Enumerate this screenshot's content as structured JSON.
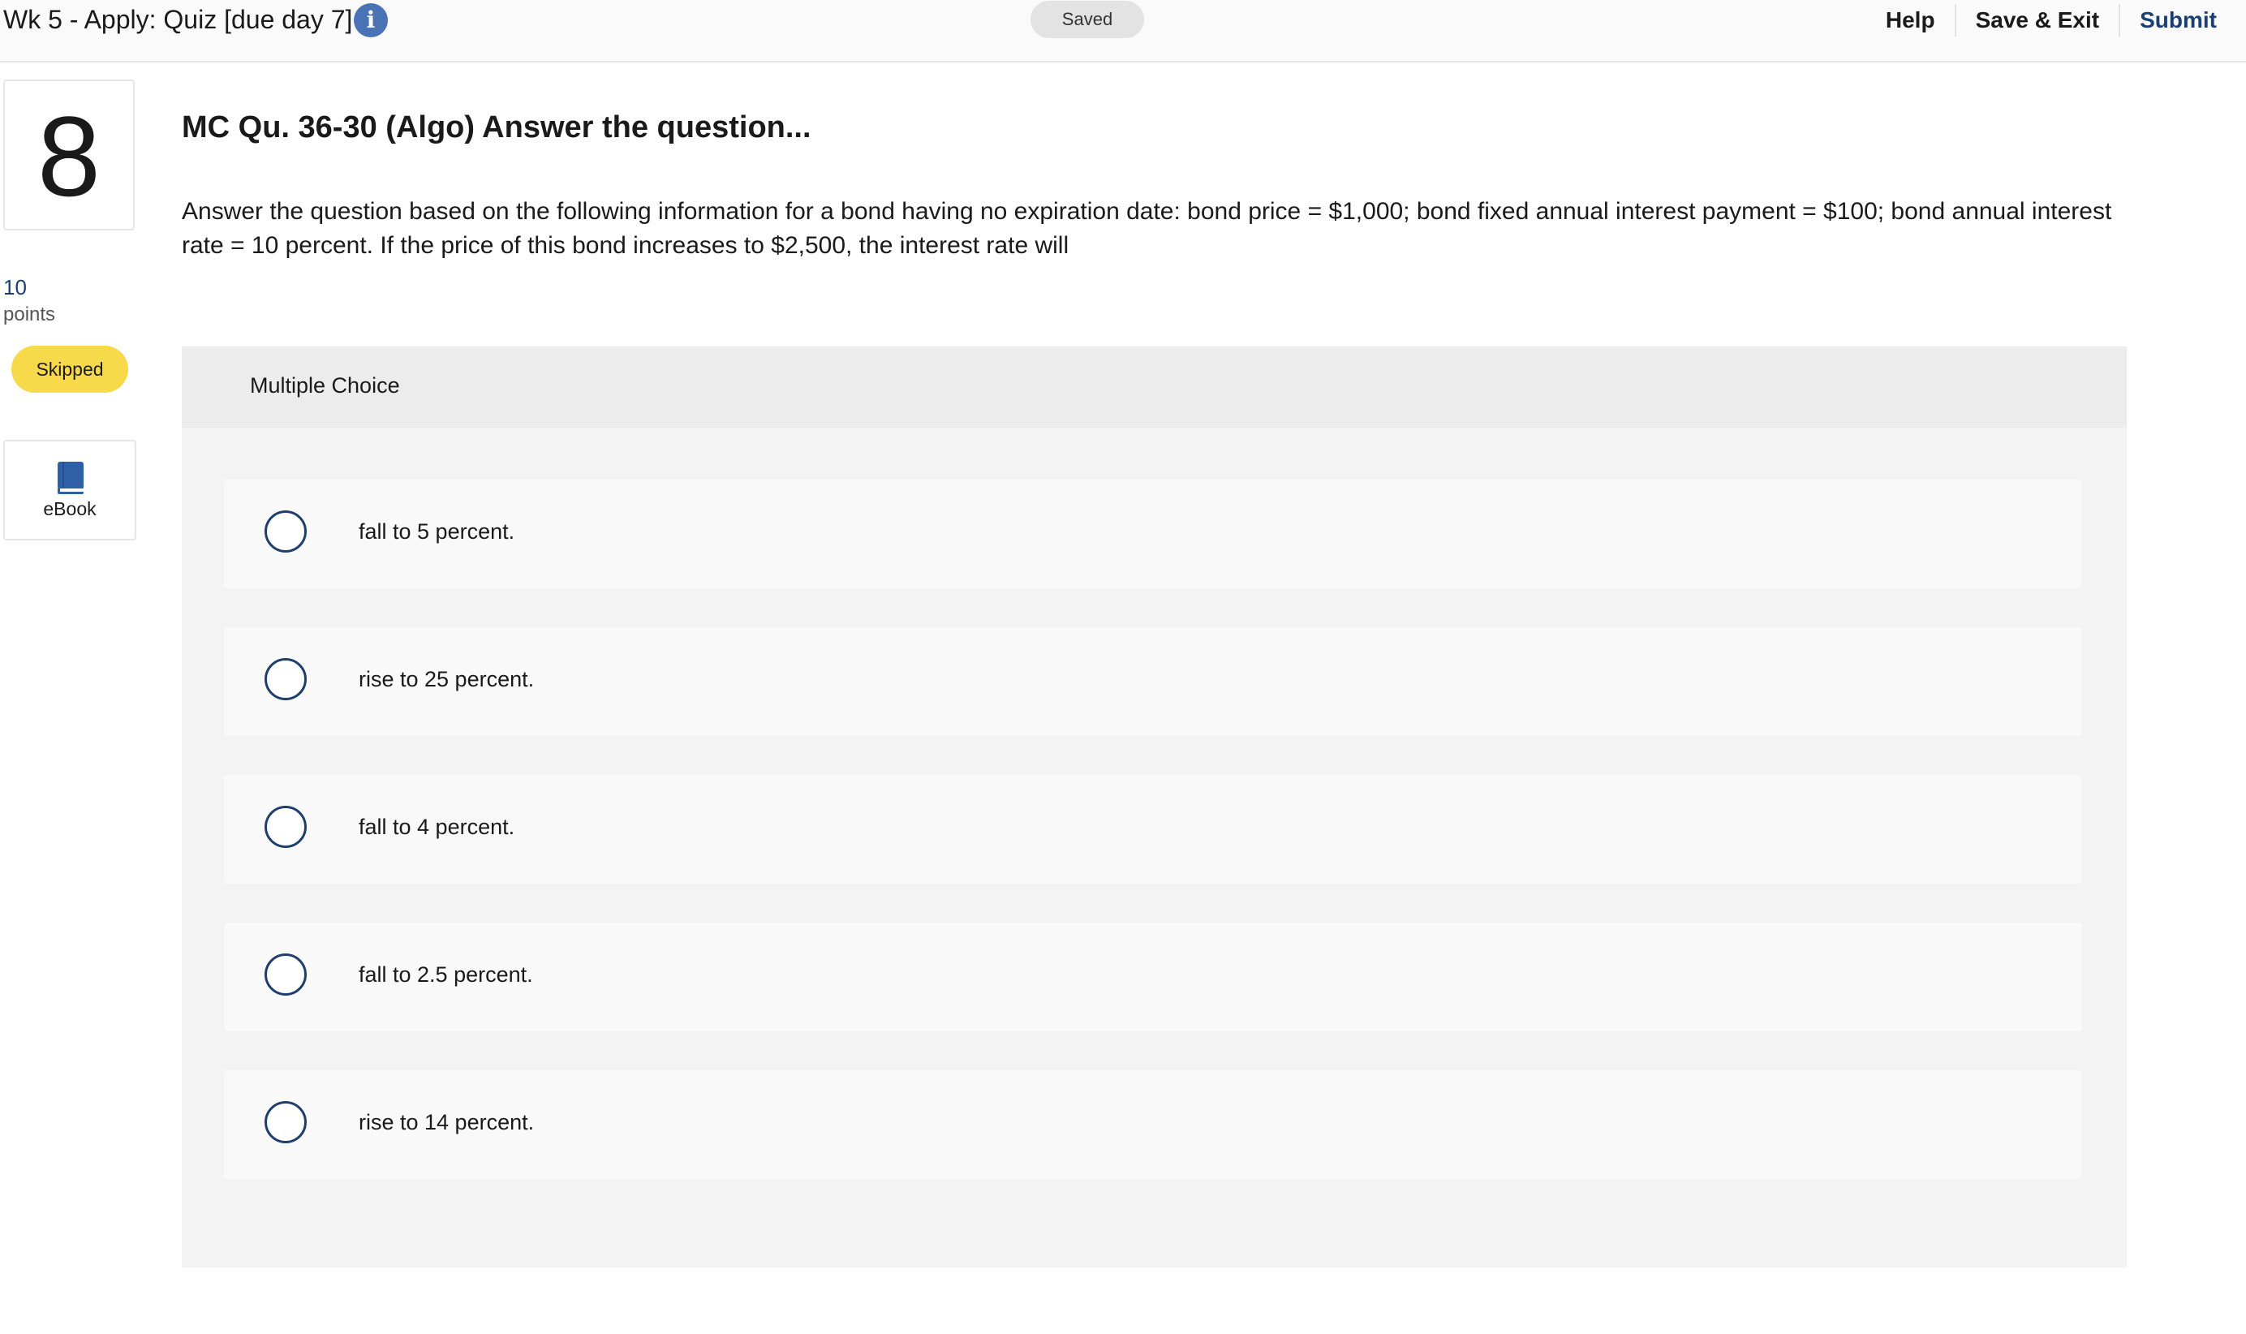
{
  "header": {
    "quiz_title": "Wk 5 - Apply: Quiz [due day 7]",
    "info_icon": "info-icon",
    "status_badge": "Saved",
    "help_label": "Help",
    "save_exit_label": "Save & Exit",
    "submit_label": "Submit"
  },
  "sidebar": {
    "question_number": "8",
    "points_value": "10",
    "points_label": "points",
    "status_badge": "Skipped",
    "ebook_icon": "book-icon",
    "ebook_label": "eBook"
  },
  "question": {
    "title": "MC Qu. 36-30 (Algo) Answer the question...",
    "text": "Answer the question based on the following information for a bond having no expiration date: bond price = $1,000; bond fixed annual interest payment = $100; bond annual interest rate = 10 percent. If the price of this bond increases to $2,500, the interest rate will"
  },
  "multiple_choice": {
    "header": "Multiple Choice",
    "options": [
      {
        "label": "fall to 5 percent.",
        "selected": false
      },
      {
        "label": "rise to 25 percent.",
        "selected": false
      },
      {
        "label": "fall to 4 percent.",
        "selected": false
      },
      {
        "label": "fall to 2.5 percent.",
        "selected": false
      },
      {
        "label": "rise to 14 percent.",
        "selected": false
      }
    ]
  },
  "colors": {
    "accent_blue": "#1b3f75",
    "info_blue": "#4a73b6",
    "skipped_yellow": "#f8d94a",
    "ebook_blue": "#2f5fa7"
  }
}
